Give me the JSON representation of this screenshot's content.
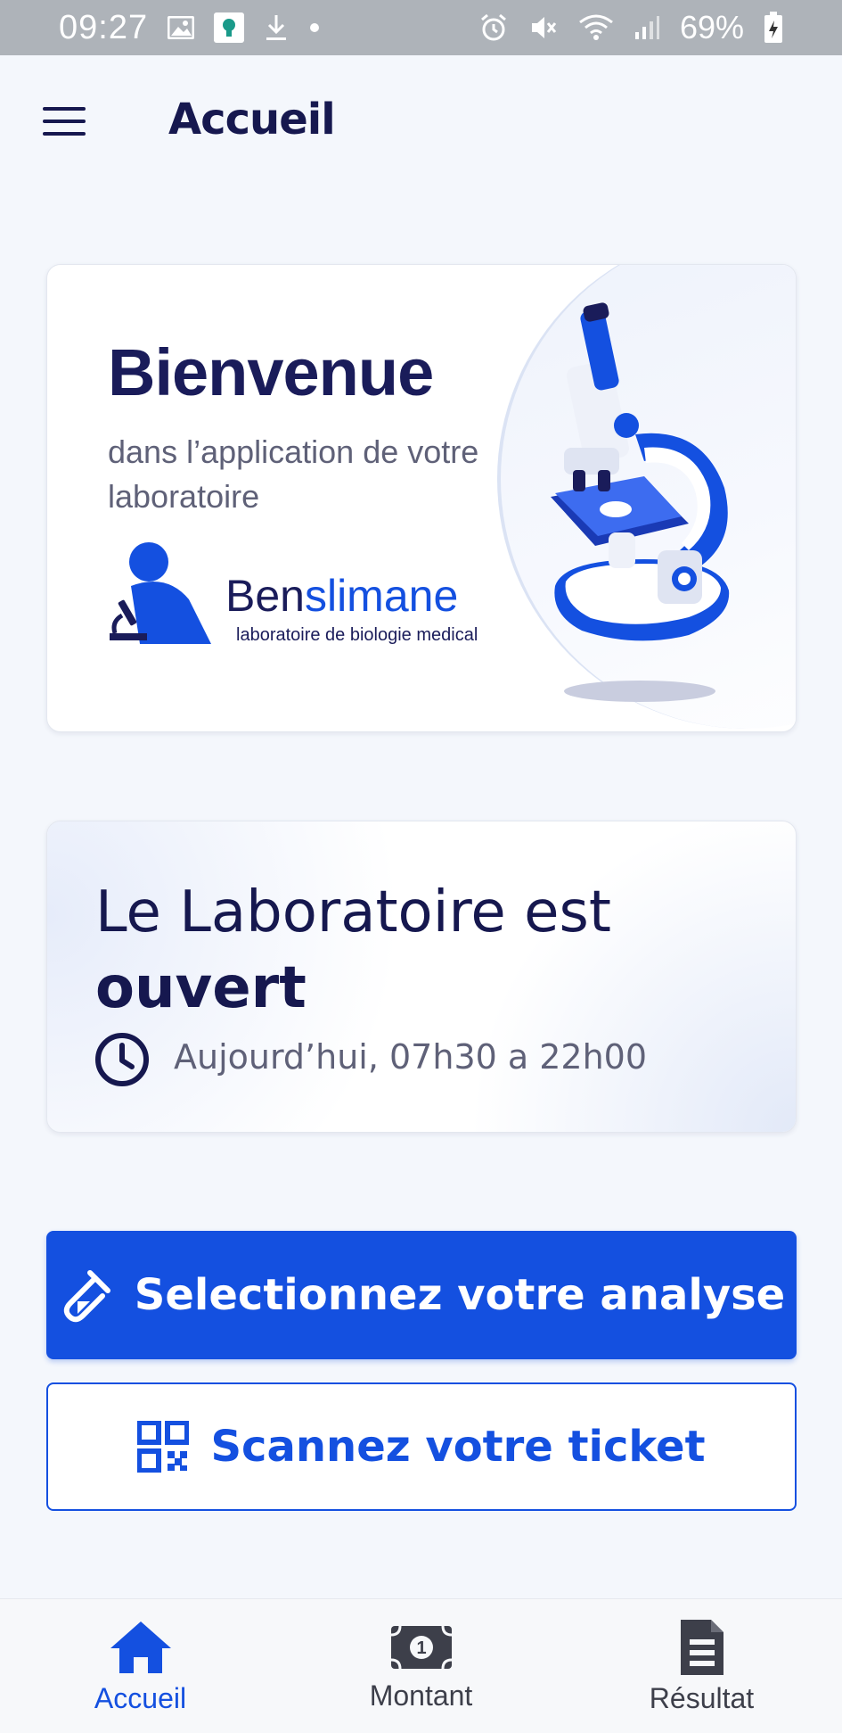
{
  "status_bar": {
    "time": "09:27",
    "battery": "69%",
    "icons": [
      "image-icon",
      "app-icon",
      "download-icon",
      "dot-icon",
      "alarm-icon",
      "mute-icon",
      "wifi-icon",
      "signal-icon",
      "battery-icon"
    ]
  },
  "header": {
    "title": "Accueil",
    "menu_icon": "hamburger-menu-icon"
  },
  "welcome_card": {
    "title": "Bienvenue",
    "subtitle": "dans l’application de votre laboratoire",
    "brand_name_part1": "Ben",
    "brand_name_part2": "slimane",
    "brand_tagline": "laboratoire de biologie medical"
  },
  "status_card": {
    "line1": "Le Laboratoire est",
    "line2": "ouvert",
    "hours": "Aujourd’hui, 07h30 a 22h00"
  },
  "actions": {
    "select_analysis": "Selectionnez votre analyse",
    "scan_ticket": "Scannez votre ticket"
  },
  "bottom_nav": {
    "items": [
      {
        "label": "Accueil",
        "icon": "home-icon",
        "active": true
      },
      {
        "label": "Montant",
        "icon": "money-icon",
        "active": false
      },
      {
        "label": "Résultat",
        "icon": "document-icon",
        "active": false
      }
    ]
  },
  "colors": {
    "primary": "#1450e0",
    "dark_text": "#16184f",
    "background": "#f4f7fc"
  }
}
